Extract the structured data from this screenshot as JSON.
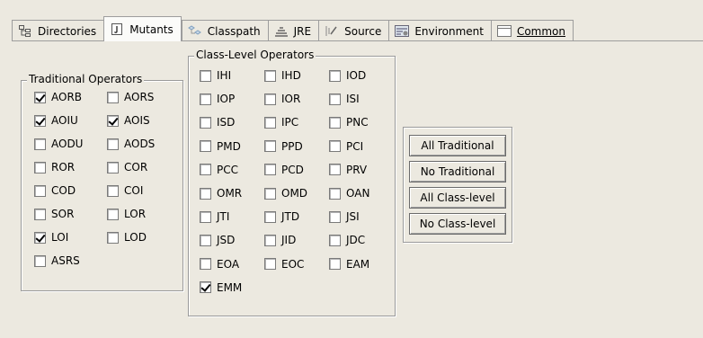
{
  "tabs": [
    {
      "label": "Directories",
      "icon": "directories-icon",
      "active": false
    },
    {
      "label": "Mutants",
      "icon": "mutants-icon",
      "active": true
    },
    {
      "label": "Classpath",
      "icon": "classpath-icon",
      "active": false
    },
    {
      "label": "JRE",
      "icon": "jre-icon",
      "active": false
    },
    {
      "label": "Source",
      "icon": "source-icon",
      "active": false
    },
    {
      "label": "Environment",
      "icon": "environment-icon",
      "active": false
    },
    {
      "label": "Common",
      "icon": "common-icon",
      "active": false
    }
  ],
  "traditional": {
    "legend": "Traditional Operators",
    "items": [
      {
        "label": "AORB",
        "checked": true
      },
      {
        "label": "AORS",
        "checked": false
      },
      {
        "label": "AOIU",
        "checked": true
      },
      {
        "label": "AOIS",
        "checked": true
      },
      {
        "label": "AODU",
        "checked": false
      },
      {
        "label": "AODS",
        "checked": false
      },
      {
        "label": "ROR",
        "checked": false
      },
      {
        "label": "COR",
        "checked": false
      },
      {
        "label": "COD",
        "checked": false
      },
      {
        "label": "COI",
        "checked": false
      },
      {
        "label": "SOR",
        "checked": false
      },
      {
        "label": "LOR",
        "checked": false
      },
      {
        "label": "LOI",
        "checked": true
      },
      {
        "label": "LOD",
        "checked": false
      },
      {
        "label": "ASRS",
        "checked": false
      }
    ]
  },
  "classlevel": {
    "legend": "Class-Level Operators",
    "items": [
      {
        "label": "IHI",
        "checked": false
      },
      {
        "label": "IHD",
        "checked": false
      },
      {
        "label": "IOD",
        "checked": false
      },
      {
        "label": "IOP",
        "checked": false
      },
      {
        "label": "IOR",
        "checked": false
      },
      {
        "label": "ISI",
        "checked": false
      },
      {
        "label": "ISD",
        "checked": false
      },
      {
        "label": "IPC",
        "checked": false
      },
      {
        "label": "PNC",
        "checked": false
      },
      {
        "label": "PMD",
        "checked": false
      },
      {
        "label": "PPD",
        "checked": false
      },
      {
        "label": "PCI",
        "checked": false
      },
      {
        "label": "PCC",
        "checked": false
      },
      {
        "label": "PCD",
        "checked": false
      },
      {
        "label": "PRV",
        "checked": false
      },
      {
        "label": "OMR",
        "checked": false
      },
      {
        "label": "OMD",
        "checked": false
      },
      {
        "label": "OAN",
        "checked": false
      },
      {
        "label": "JTI",
        "checked": false
      },
      {
        "label": "JTD",
        "checked": false
      },
      {
        "label": "JSI",
        "checked": false
      },
      {
        "label": "JSD",
        "checked": false
      },
      {
        "label": "JID",
        "checked": false
      },
      {
        "label": "JDC",
        "checked": false
      },
      {
        "label": "EOA",
        "checked": false
      },
      {
        "label": "EOC",
        "checked": false
      },
      {
        "label": "EAM",
        "checked": false
      },
      {
        "label": "EMM",
        "checked": true
      }
    ]
  },
  "buttons": [
    {
      "label": "All Traditional",
      "name": "all-traditional-button"
    },
    {
      "label": "No Traditional",
      "name": "no-traditional-button"
    },
    {
      "label": "All Class-level",
      "name": "all-class-level-button"
    },
    {
      "label": "No Class-level",
      "name": "no-class-level-button"
    }
  ]
}
